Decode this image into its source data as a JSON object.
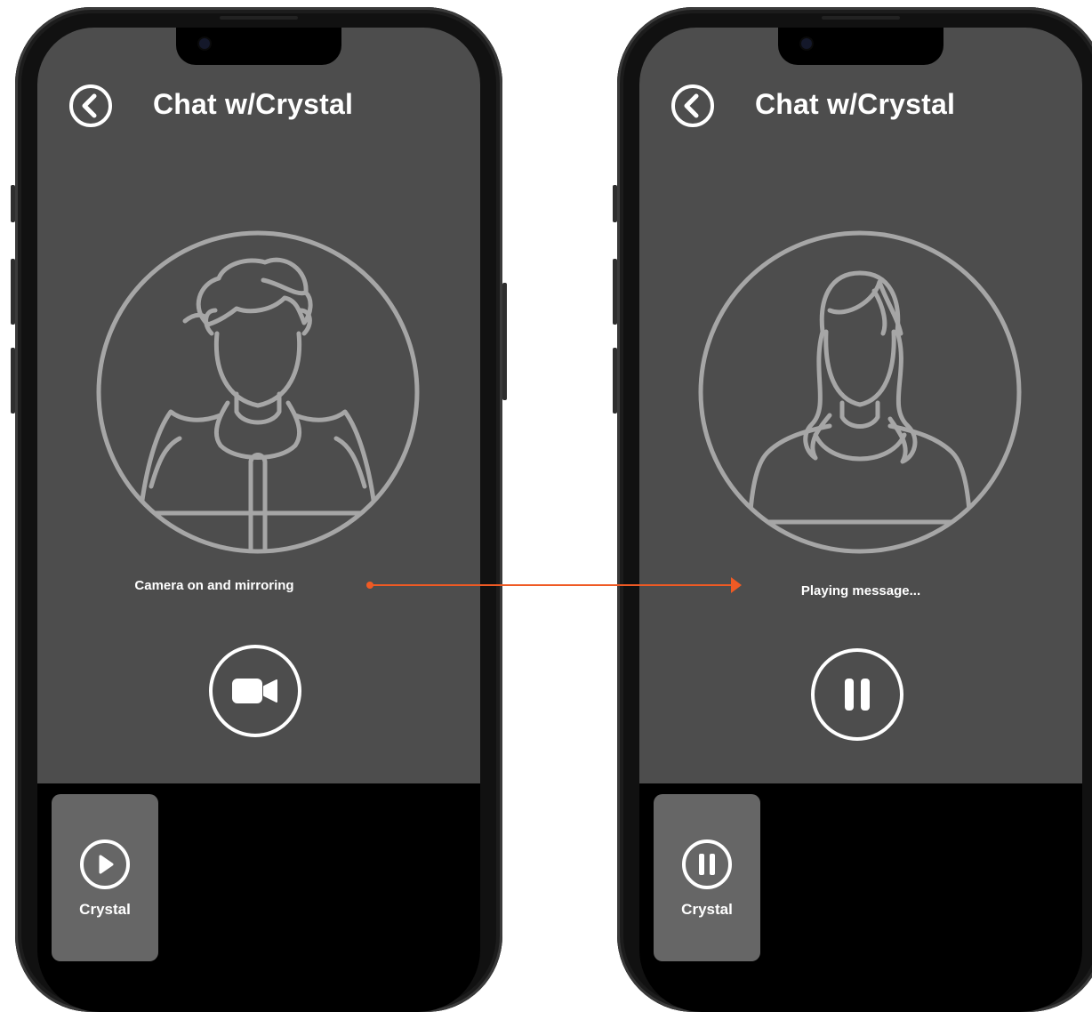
{
  "screens": [
    {
      "title": "Chat w/Crystal",
      "status": "Camera on and mirroring",
      "action": "video-camera",
      "avatar": "male-avatar",
      "message_card": {
        "name": "Crystal",
        "icon": "play-icon"
      }
    },
    {
      "title": "Chat w/Crystal",
      "status": "Playing message...",
      "action": "pause",
      "avatar": "female-avatar",
      "message_card": {
        "name": "Crystal",
        "icon": "pause-icon"
      }
    }
  ],
  "colors": {
    "screen_bg": "#4d4d4d",
    "avatar_stroke": "#a6a6a6",
    "accent_arrow": "#ef5a24",
    "card_bg": "#666666"
  }
}
